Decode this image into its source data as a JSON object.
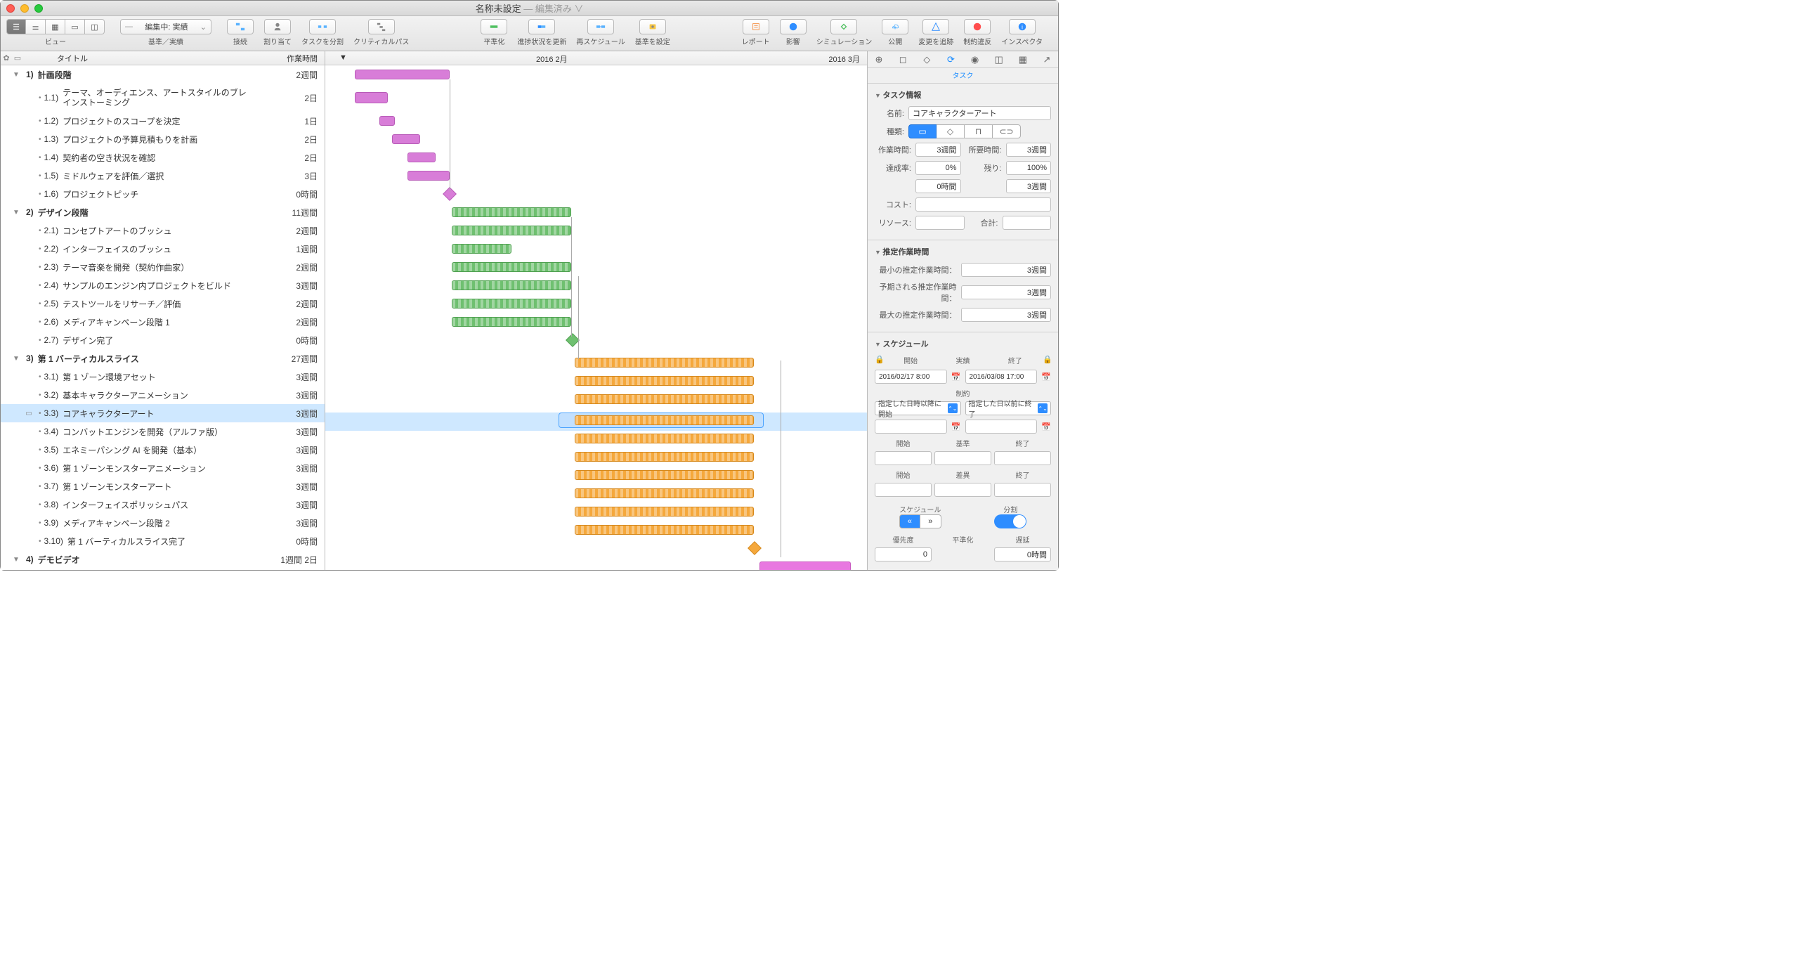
{
  "window": {
    "title": "名称未設定",
    "edited": "— 編集済み ∨"
  },
  "toolbar": {
    "view_label": "ビュー",
    "baseline_label": "基準／実績",
    "baseline_dropdown": "編集中: 実績",
    "connect": "接続",
    "assign": "割り当て",
    "split": "タスクを分割",
    "critical": "クリティカルパス",
    "level": "平準化",
    "update": "進捗状況を更新",
    "reschedule": "再スケジュール",
    "baseline_set": "基準を設定",
    "report": "レポート",
    "impact": "影響",
    "sim": "シミュレーション",
    "publish": "公開",
    "track": "変更を追跡",
    "violation": "制約違反",
    "inspector": "インスペクタ"
  },
  "outline": {
    "header_title": "タイトル",
    "header_dur": "作業時間",
    "rows": [
      {
        "lvl": 0,
        "disc": "▼",
        "num": "1)",
        "label": "計画段階",
        "dur": "2週間"
      },
      {
        "lvl": 1,
        "h2": true,
        "num": "1.1)",
        "label": "テーマ、オーディエンス、アートスタイルのブレインストーミング",
        "dur": "2日"
      },
      {
        "lvl": 1,
        "num": "1.2)",
        "label": "プロジェクトのスコープを決定",
        "dur": "1日"
      },
      {
        "lvl": 1,
        "num": "1.3)",
        "label": "プロジェクトの予算見積もりを計画",
        "dur": "2日"
      },
      {
        "lvl": 1,
        "num": "1.4)",
        "label": "契約者の空き状況を確認",
        "dur": "2日"
      },
      {
        "lvl": 1,
        "num": "1.5)",
        "label": "ミドルウェアを評価／選択",
        "dur": "3日"
      },
      {
        "lvl": 1,
        "num": "1.6)",
        "label": "プロジェクトピッチ",
        "dur": "0時間"
      },
      {
        "lvl": 0,
        "disc": "▼",
        "num": "2)",
        "label": "デザイン段階",
        "dur": "11週間"
      },
      {
        "lvl": 1,
        "num": "2.1)",
        "label": "コンセプトアートのブッシュ",
        "dur": "2週間"
      },
      {
        "lvl": 1,
        "num": "2.2)",
        "label": "インターフェイスのブッシュ",
        "dur": "1週間"
      },
      {
        "lvl": 1,
        "num": "2.3)",
        "label": "テーマ音楽を開発（契約作曲家）",
        "dur": "2週間"
      },
      {
        "lvl": 1,
        "num": "2.4)",
        "label": "サンプルのエンジン内プロジェクトをビルド",
        "dur": "3週間"
      },
      {
        "lvl": 1,
        "num": "2.5)",
        "label": "テストツールをリサーチ／評価",
        "dur": "2週間"
      },
      {
        "lvl": 1,
        "num": "2.6)",
        "label": "メディアキャンペーン段階 1",
        "dur": "2週間"
      },
      {
        "lvl": 1,
        "num": "2.7)",
        "label": "デザイン完了",
        "dur": "0時間"
      },
      {
        "lvl": 0,
        "disc": "▼",
        "num": "3)",
        "label": "第 1 バーティカルスライス",
        "dur": "27週間"
      },
      {
        "lvl": 1,
        "num": "3.1)",
        "label": "第 1 ゾーン環境アセット",
        "dur": "3週間"
      },
      {
        "lvl": 1,
        "num": "3.2)",
        "label": "基本キャラクターアニメーション",
        "dur": "3週間"
      },
      {
        "lvl": 1,
        "sel": true,
        "num": "3.3)",
        "label": "コアキャラクターアート",
        "dur": "3週間"
      },
      {
        "lvl": 1,
        "num": "3.4)",
        "label": "コンバットエンジンを開発（アルファ版）",
        "dur": "3週間"
      },
      {
        "lvl": 1,
        "num": "3.5)",
        "label": "エネミーパシング AI を開発（基本）",
        "dur": "3週間"
      },
      {
        "lvl": 1,
        "num": "3.6)",
        "label": "第 1 ゾーンモンスターアニメーション",
        "dur": "3週間"
      },
      {
        "lvl": 1,
        "num": "3.7)",
        "label": "第 1 ゾーンモンスターアート",
        "dur": "3週間"
      },
      {
        "lvl": 1,
        "num": "3.8)",
        "label": "インターフェイスポリッシュパス",
        "dur": "3週間"
      },
      {
        "lvl": 1,
        "num": "3.9)",
        "label": "メディアキャンペーン段階 2",
        "dur": "3週間"
      },
      {
        "lvl": 1,
        "num": "3.10)",
        "label": "第 1 バーティカルスライス完了",
        "dur": "0時間"
      },
      {
        "lvl": 0,
        "disc": "▼",
        "num": "4)",
        "label": "デモビデオ",
        "dur": "1週間 2日"
      }
    ]
  },
  "gantt": {
    "month1": "2016 2月",
    "month2": "2016 3月"
  },
  "inspector": {
    "tab": "タスク",
    "sec_task": "タスク情報",
    "name_label": "名前:",
    "name_value": "コアキャラクターアート",
    "type_label": "種類:",
    "work_label": "作業時間:",
    "work_value": "3週間",
    "duration_label": "所要時間:",
    "duration_value": "3週間",
    "complete_label": "達成率:",
    "complete_value": "0%",
    "remain_label": "残り:",
    "remain_value": "100%",
    "complete_time": "0時間",
    "remain_time": "3週間",
    "cost_label": "コスト:",
    "resource_label": "リソース:",
    "total_label": "合計:",
    "sec_est": "推定作業時間",
    "est_min_label": "最小の推定作業時間：",
    "est_min": "3週間",
    "est_exp_label": "予期される推定作業時間：",
    "est_exp": "3週間",
    "est_max_label": "最大の推定作業時間：",
    "est_max": "3週間",
    "sec_sched": "スケジュール",
    "start_hdr": "開始",
    "actual_hdr": "実績",
    "end_hdr": "終了",
    "start_date": "2016/02/17 8:00",
    "end_date": "2016/03/08 17:00",
    "constraint_hdr": "制約",
    "constraint_start": "指定した日時以降に開始",
    "constraint_end": "指定した日以前に終了",
    "baseline_hdr": "基準",
    "variance_hdr": "差異",
    "sched_btn_label": "スケジュール",
    "split_btn_label": "分割",
    "priority_label": "優先度",
    "priority_value": "0",
    "level_label": "平準化",
    "delay_label": "遅延",
    "delay_value": "0時間"
  }
}
